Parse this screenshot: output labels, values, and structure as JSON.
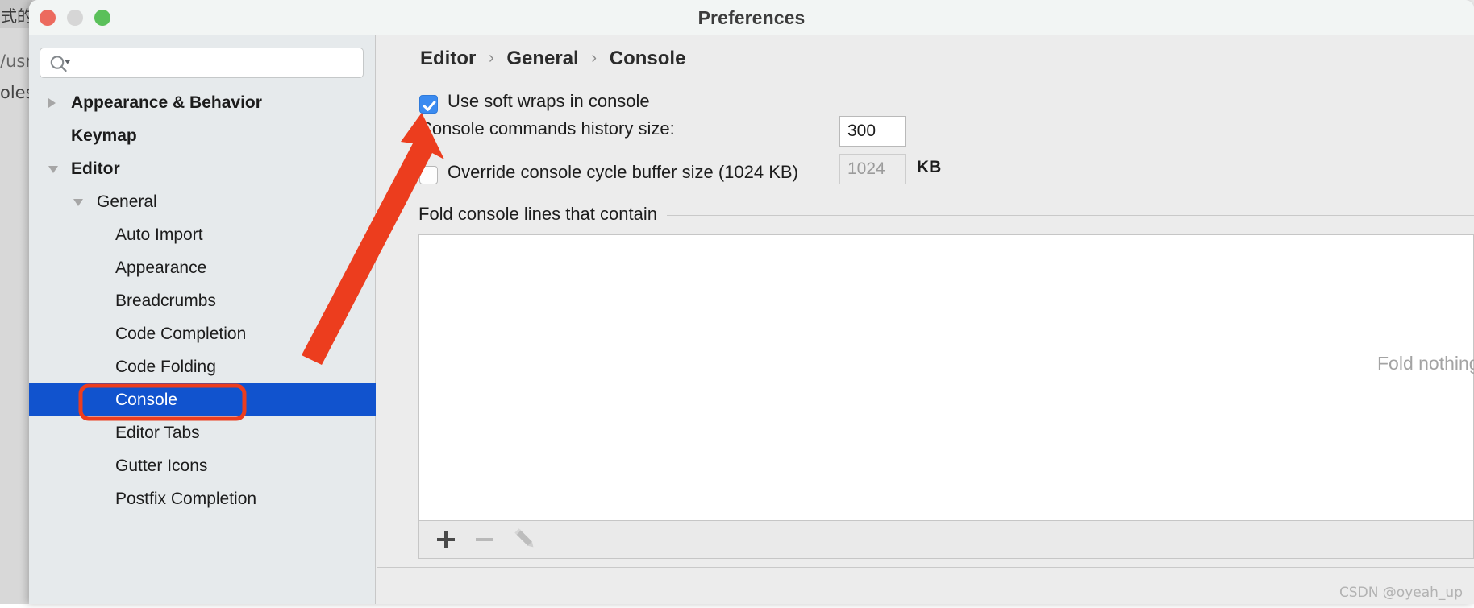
{
  "background": {
    "text_lines": [
      "式的",
      "/usr",
      "oles"
    ]
  },
  "window": {
    "title": "Preferences",
    "controls": [
      {
        "name": "close",
        "color": "#ec6a5e"
      },
      {
        "name": "minimize",
        "color": "#d6d6d6"
      },
      {
        "name": "maximize",
        "color": "#5ac05a"
      }
    ]
  },
  "sidebar": {
    "search": {
      "value": "",
      "placeholder": "",
      "icon": "search-icon"
    },
    "tree": [
      {
        "label": "Appearance & Behavior",
        "level": 0,
        "twisty": "collapsed",
        "selected": false
      },
      {
        "label": "Keymap",
        "level": 0,
        "twisty": "none",
        "selected": false
      },
      {
        "label": "Editor",
        "level": 0,
        "twisty": "expanded",
        "selected": false
      },
      {
        "label": "General",
        "level": 1,
        "twisty": "expanded",
        "selected": false
      },
      {
        "label": "Auto Import",
        "level": 2,
        "twisty": "none",
        "selected": false
      },
      {
        "label": "Appearance",
        "level": 2,
        "twisty": "none",
        "selected": false
      },
      {
        "label": "Breadcrumbs",
        "level": 2,
        "twisty": "none",
        "selected": false
      },
      {
        "label": "Code Completion",
        "level": 2,
        "twisty": "none",
        "selected": false
      },
      {
        "label": "Code Folding",
        "level": 2,
        "twisty": "none",
        "selected": false
      },
      {
        "label": "Console",
        "level": 2,
        "twisty": "none",
        "selected": true
      },
      {
        "label": "Editor Tabs",
        "level": 2,
        "twisty": "none",
        "selected": false
      },
      {
        "label": "Gutter Icons",
        "level": 2,
        "twisty": "none",
        "selected": false
      },
      {
        "label": "Postfix Completion",
        "level": 2,
        "twisty": "none",
        "selected": false
      }
    ]
  },
  "content": {
    "breadcrumb": {
      "root": "Editor",
      "middle": "General",
      "leaf": "Console",
      "separator": "›"
    },
    "soft_wraps": {
      "label": "Use soft wraps in console",
      "checked": true
    },
    "history": {
      "label": "Console commands history size:",
      "value": "300"
    },
    "override_cycle_buffer": {
      "label": "Override console cycle buffer size (1024 KB)",
      "checked": false,
      "value": "1024",
      "unit": "KB"
    },
    "fold_section": {
      "title": "Fold console lines that contain",
      "empty_text": "Fold nothing",
      "toolbar": [
        {
          "name": "add-button",
          "glyph": "+"
        },
        {
          "name": "remove-button",
          "glyph": "−"
        },
        {
          "name": "edit-button",
          "glyph": "pencil"
        }
      ]
    }
  },
  "annotations": {
    "arrow_color": "#ec3d1e",
    "highlight_color": "#ec3d1e",
    "arrow_target": "Use soft wraps in console checkbox",
    "highlight_target": "Console tree item"
  },
  "watermark": "CSDN @oyeah_up"
}
